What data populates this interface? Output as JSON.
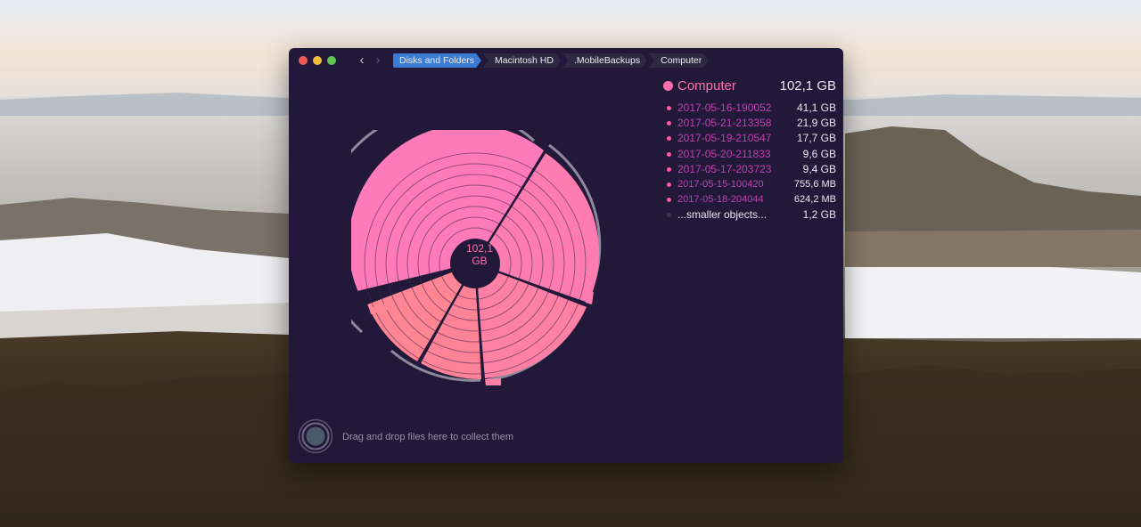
{
  "window": {
    "nav": {
      "back_icon": "‹",
      "forward_icon": "›"
    },
    "breadcrumbs": [
      "Disks and Folders",
      "Macintosh HD",
      ".MobileBackups",
      "Computer"
    ]
  },
  "chart": {
    "center_value": "102,1",
    "center_unit": "GB"
  },
  "panel": {
    "title": "Computer",
    "total": "102,1 GB",
    "items": [
      {
        "name": "2017-05-16-190052",
        "size": "41,1 GB"
      },
      {
        "name": "2017-05-21-213358",
        "size": "21,9 GB"
      },
      {
        "name": "2017-05-19-210547",
        "size": "17,7 GB"
      },
      {
        "name": "2017-05-20-211833",
        "size": "9,6 GB"
      },
      {
        "name": "2017-05-17-203723",
        "size": "9,4 GB"
      },
      {
        "name": "2017-05-15-100420",
        "size": "755,6 MB"
      },
      {
        "name": "2017-05-18-204044",
        "size": "624,2 MB"
      }
    ],
    "other": {
      "name": "...smaller objects...",
      "size": "1,2 GB"
    }
  },
  "drop_zone": {
    "text": "Drag and drop files here to collect them"
  },
  "colors": {
    "accent_pink": "#ff6fae",
    "window_bg": "#22193a",
    "crumb_selected": "#3a7bd5",
    "item_name": "#c23fb0"
  }
}
